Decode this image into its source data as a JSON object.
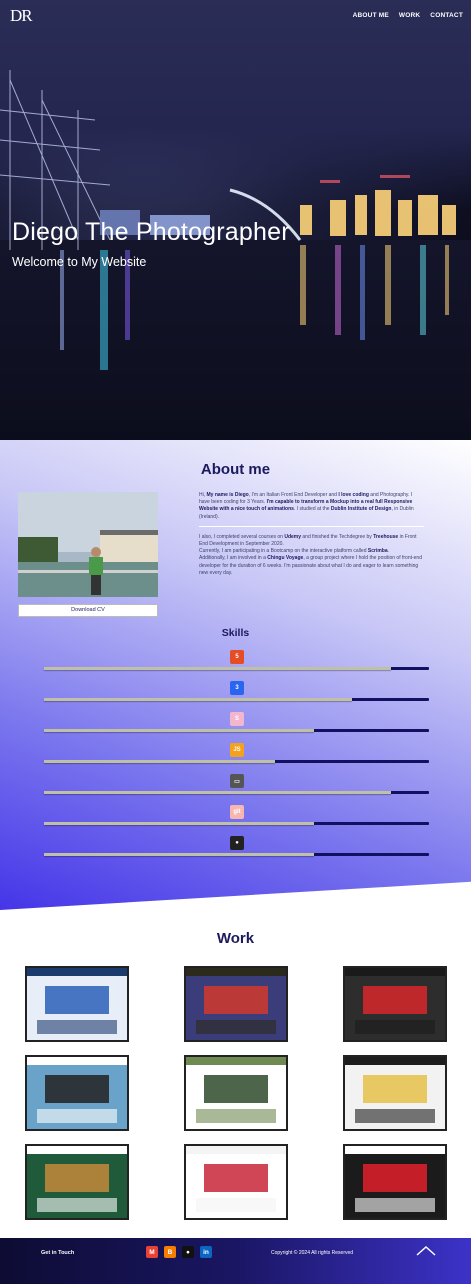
{
  "header": {
    "logo": "DR",
    "nav": [
      "ABOUT ME",
      "WORK",
      "CONTACT"
    ]
  },
  "hero": {
    "title": "Diego The Photographer",
    "subtitle": "Welcome to My Website"
  },
  "about": {
    "title": "About me",
    "cv_button": "Download CV",
    "bio_p1": [
      {
        "t": "Hi, ",
        "b": false
      },
      {
        "t": "My name is Diego",
        "b": true
      },
      {
        "t": ", I'm an Italian Front End Developer and ",
        "b": false
      },
      {
        "t": "I love coding",
        "b": true
      },
      {
        "t": " and Photography. I have been coding for 3 Years. ",
        "b": false
      },
      {
        "t": "I'm capable to transform a Mockup into a real full Responsive Website with a nice touch of animations",
        "b": true
      },
      {
        "t": ". I studied at the ",
        "b": false
      },
      {
        "t": "Dublin Institute of Design",
        "b": true
      },
      {
        "t": ", in Dublin (Ireland).",
        "b": false
      }
    ],
    "bio_p2": [
      {
        "t": "I also, I completed several courses on ",
        "b": false
      },
      {
        "t": "Udemy",
        "b": true
      },
      {
        "t": " and finished the Techdegree by ",
        "b": false
      },
      {
        "t": "Treehouse",
        "b": true
      },
      {
        "t": " in Front End Development in September 2020.",
        "b": false
      }
    ],
    "bio_p3": [
      {
        "t": "Currently, I am participating in a Bootcamp on the interactive platform called ",
        "b": false
      },
      {
        "t": "Scrimba",
        "b": true
      },
      {
        "t": ".",
        "b": false
      }
    ],
    "bio_p4": [
      {
        "t": "Additionally, I am involved in a ",
        "b": false
      },
      {
        "t": "Chingu Voyage",
        "b": true
      },
      {
        "t": ", a group project where I hold the position of front-end developer for the duration of 6 weeks. I'm passionate about what I do and eager to learn something new every day.",
        "b": false
      }
    ]
  },
  "skills": {
    "title": "Skills",
    "items": [
      {
        "name": "html5-icon",
        "glyph": "5",
        "color": "#e44d26",
        "level": 0.9
      },
      {
        "name": "css3-icon",
        "glyph": "3",
        "color": "#2965f1",
        "level": 0.8
      },
      {
        "name": "sass-icon",
        "glyph": "S",
        "color": "#f3b6cf",
        "level": 0.7
      },
      {
        "name": "javascript-icon",
        "glyph": "JS",
        "color": "#f4a11e",
        "level": 0.6
      },
      {
        "name": "responsive-icon",
        "glyph": "▭",
        "color": "#555555",
        "level": 0.9
      },
      {
        "name": "git-icon",
        "glyph": "git",
        "color": "#f8b6b0",
        "level": 0.7
      },
      {
        "name": "github-icon",
        "glyph": "●",
        "color": "#222222",
        "level": 0.7
      }
    ]
  },
  "work": {
    "title": "Work",
    "projects": [
      {
        "name": "project-1",
        "head": "#1b3a6e",
        "body": "#e8eef8",
        "accent": "#2b5fb8"
      },
      {
        "name": "project-2",
        "head": "#2b2a1c",
        "body": "#3b3d7a",
        "accent": "#d23a2c"
      },
      {
        "name": "project-3",
        "head": "#1a1a1a",
        "body": "#2d2d2d",
        "accent": "#d8282a"
      },
      {
        "name": "project-4",
        "head": "#ffffff",
        "body": "#6aa3c9",
        "accent": "#222222"
      },
      {
        "name": "project-5",
        "head": "#6f8b52",
        "body": "#ffffff",
        "accent": "#2e4a2a"
      },
      {
        "name": "project-6",
        "head": "#1d1d1d",
        "body": "#f2f2f2",
        "accent": "#e5c14a"
      },
      {
        "name": "project-7",
        "head": "#ffffff",
        "body": "#1f5a3a",
        "accent": "#c68a3b"
      },
      {
        "name": "project-8",
        "head": "#f4f4f4",
        "body": "#ffffff",
        "accent": "#c9263a"
      },
      {
        "name": "project-9",
        "head": "#ffffff",
        "body": "#1b1b1b",
        "accent": "#e21e2a"
      }
    ]
  },
  "footer": {
    "get_in_touch": "Get in Touch",
    "copyright": "Copyright © 2024 All rights Reserved",
    "socials": [
      {
        "name": "gmail-icon",
        "glyph": "M",
        "color": "#e94235"
      },
      {
        "name": "blogger-icon",
        "glyph": "B",
        "color": "#f57d00"
      },
      {
        "name": "github-footer-icon",
        "glyph": "●",
        "color": "#111111"
      },
      {
        "name": "linkedin-icon",
        "glyph": "in",
        "color": "#0a66c2"
      }
    ]
  }
}
